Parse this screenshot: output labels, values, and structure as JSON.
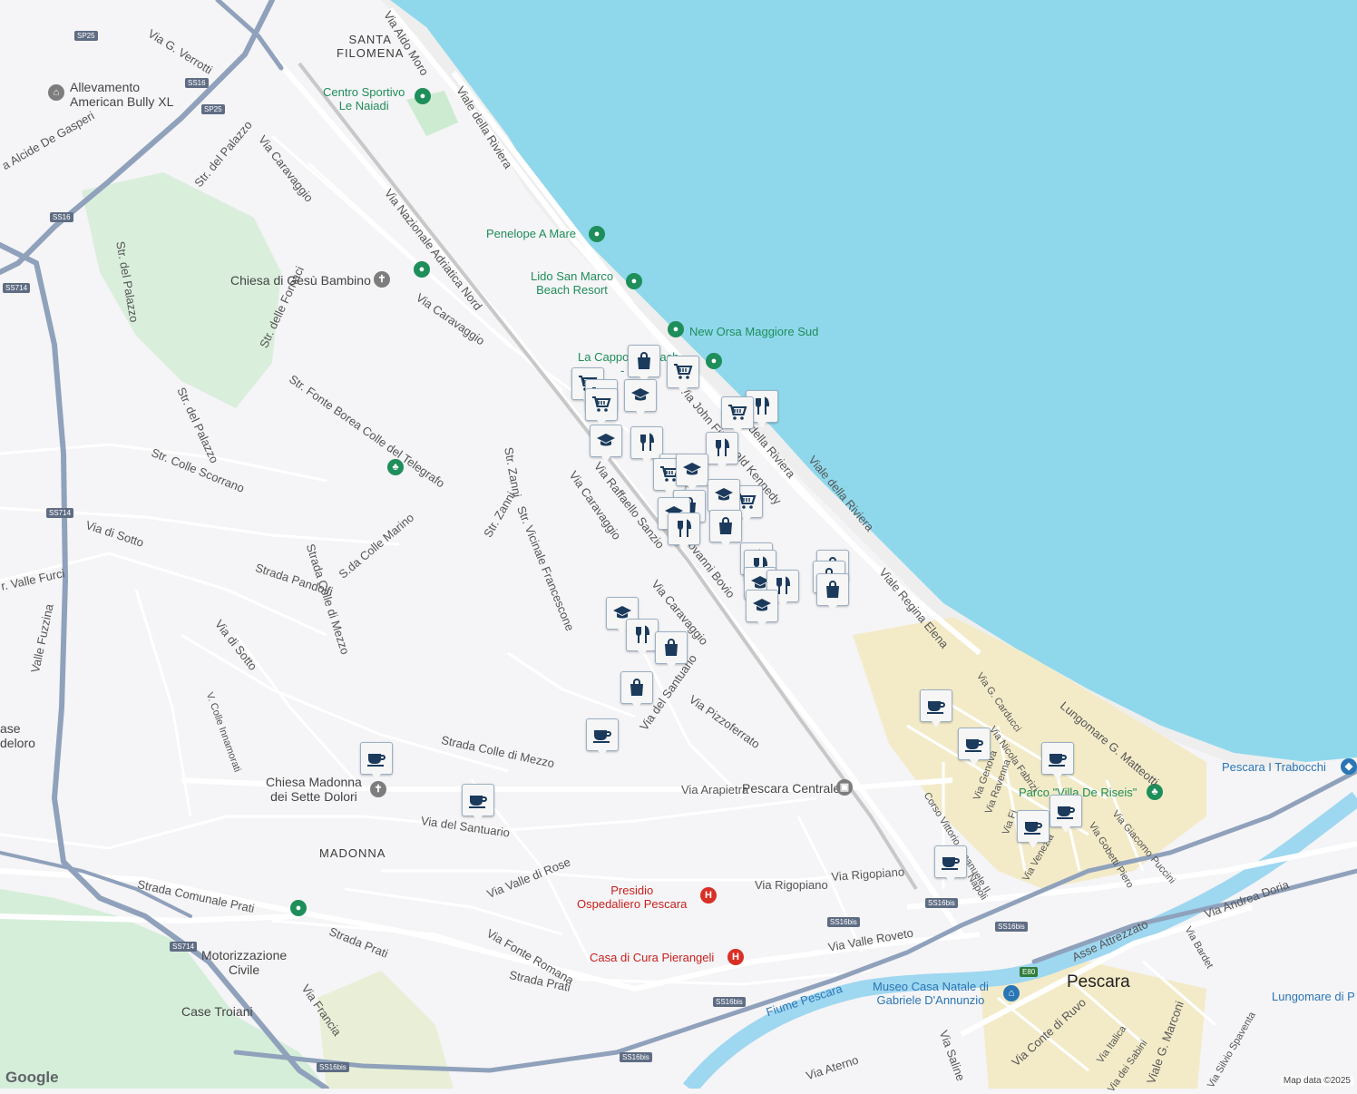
{
  "colors": {
    "sea": "#8fd8ec",
    "land": "#f5f4f6",
    "road": "#ffffff",
    "highway": "#8fa1bb",
    "park": "#cdebd1",
    "river": "#9ed7f0",
    "center": "#f3ebc8",
    "poi_green": "#1e8e5a",
    "marker_navy": "#1b3a5c"
  },
  "areas": {
    "santa_filomena": "SANTA\nFILOMENA",
    "madonna": "MADONNA",
    "case_troiani": "Case Troiani",
    "case_deloro": "ase\ndeloro"
  },
  "city": {
    "pescara": "Pescara"
  },
  "pois": {
    "allevamento": "Allevamento\nAmerican Bully XL",
    "centro_sportivo": "Centro Sportivo\nLe Naiadi",
    "penelope": "Penelope A Mare",
    "lido_san_marco": "Lido San Marco\nBeach Resort",
    "new_orsa": "New Orsa Maggiore Sud",
    "la_capponi": "La Cappo     Beach\n             - S",
    "chiesa_gesu": "Chiesa di Gesù Bambino",
    "chiesa_madonna": "Chiesa Madonna\ndei Sette Dolori",
    "motorizzazione": "Motorizzazione\nCivile",
    "pescara_centrale": "Pescara Centrale",
    "presidio": "Presidio\nOspedaliero Pescara",
    "casa_cura": "Casa di Cura Pierangeli",
    "museo": "Museo Casa Natale di\nGabriele D'Annunzio",
    "parco": "Parco \"Villa De Riseis\"",
    "trabocchi": "Pescara I Trabocchi",
    "lungomare_di_p": "Lungomare di P"
  },
  "streets": {
    "via_g_verrotti": "Via G. Verrotti",
    "via_aldo_moro": "Via Aldo Moro",
    "viale_della_riviera_n": "Viale della Riviera",
    "via_alcide": "a Alcide De Gasperi",
    "str_del_palazzo_1": "Str. del Palazzo",
    "via_caravaggio_1": "Via Caravaggio",
    "via_nazionale": "Via Nazionale Adriatica Nord",
    "str_del_palazzo_2": "Str. del Palazzo",
    "str_delle_fornaci": "Str. delle Fornaci",
    "via_caravaggio_2": "Via Caravaggio",
    "str_fonte_borea": "Str. Fonte Borea Colle del Telegrafo",
    "str_del_palazzo_3": "Str. del Palazzo",
    "str_colle_scorrano": "Str. Colle Scorrano",
    "str_zanni_1": "Str. Zanni",
    "str_zanni_2": "Str. Zanni",
    "str_vicinale": "Str. Vicinale Francescone",
    "via_caravaggio_3": "Via Caravaggio",
    "via_raffaello": "Via Raffaello Sanzio",
    "via_giovanni_bovio": "Via Giovanni Bovio",
    "via_kennedy": "Via John Fitzgerald Kennedy",
    "viale_della_riviera_m": "della Riviera",
    "viale_della_riviera_s": "Viale della Riviera",
    "viale_regina_elena": "Viale Regina Elena",
    "via_di_sotto_1": "Via di Sotto",
    "via_di_sotto_2": "Via di Sotto",
    "strada_pandolfi": "Strada Pandolfi",
    "s_da_colle_marino": "S.da Colle Marino",
    "strada_colle_di_mezzo_v": "Strada Colle di Mezzo",
    "str_valle_furci": "r. Valle Furci",
    "valle_fuzzina": "Valle Fuzzina",
    "via_caravaggio_4": "Via Caravaggio",
    "via_del_santuario_1": "Via del Santuario",
    "via_pizzoferrato": "Via Pizzoferrato",
    "v_colle_innamorati": "V. Colle Innamorati",
    "strada_colle_di_mezzo_h": "Strada Colle di Mezzo",
    "via_arapietra": "Via Arapietra",
    "via_del_santuario_2": "Via del Santuario",
    "via_valle_di_rose": "Via Valle di Rose",
    "via_rigopiano_1": "Via Rigopiano",
    "via_rigopiano_2": "Via Rigopiano",
    "strada_comunale_prati": "Strada Comunale Prati",
    "strada_prati_1": "Strada Prati",
    "strada_prati_2": "Strada Prati",
    "via_fonte_romana": "Via Fonte Romana",
    "via_francia": "Via Francia",
    "via_valle_roveto": "Via Valle Roveto",
    "fiume_pescara": "Fiume Pescara",
    "via_aterno": "Via Aterno",
    "via_saline": "Via Saline",
    "via_conte_di_ruvo": "Via Conte di Ruvo",
    "via_italica": "Via Italica",
    "via_dei_sabini": "Via dei Sabini",
    "viale_g_marconi": "Viale G. Marconi",
    "via_silvio_spaventa": "Via Silvio Spaventa",
    "via_andrea_doria": "Via Andrea Doria",
    "via_bardet": "Via Bardet",
    "asse_attrezzato": "Asse Attrezzato",
    "via_g_carducci": "Via G. Carducci",
    "via_nicola_fabrizi": "Via Nicola Fabrizi",
    "lungomare_matteotti": "Lungomare G. Matteotti",
    "via_genova": "Via Genova",
    "via_ravenna": "Via Ravenna",
    "corso_vittorio": "Corso Vittorio Emanuele II",
    "via_venezia": "Via Venezia",
    "via_gobetti": "Via Gobetti Piero",
    "via_giacomo_puccini": "Via Giacomo Puccini",
    "via_napoli": "Napoli",
    "via_fi": "Via Fi",
    "corso_so": "so"
  },
  "shields": {
    "sp25a": "SP25",
    "ss16a": "SS16",
    "sp25b": "SP25",
    "ss16b": "SS16",
    "ss714a": "SS714",
    "ss714b": "SS714",
    "ss714c": "SS714",
    "ss16bis_a": "SS16bis",
    "ss16bis_b": "SS16bis",
    "ss16bis_c": "SS16bis",
    "ss16bis_d": "SS16bis",
    "ss16bis_e": "SS16bis",
    "ss16bis_f": "SS16bis",
    "e80": "E80"
  },
  "markers": [
    {
      "icon": "shop-bag"
    },
    {
      "icon": "cart"
    },
    {
      "icon": "cart"
    },
    {
      "icon": "cart"
    },
    {
      "icon": "school"
    },
    {
      "icon": "cart"
    },
    {
      "icon": "restaurant"
    },
    {
      "icon": "cart"
    },
    {
      "icon": "restaurant"
    },
    {
      "icon": "school"
    },
    {
      "icon": "restaurant"
    },
    {
      "icon": "restaurant"
    },
    {
      "icon": "cart"
    },
    {
      "icon": "school"
    },
    {
      "icon": "shop-bag"
    },
    {
      "icon": "school"
    },
    {
      "icon": "cart"
    },
    {
      "icon": "school"
    },
    {
      "icon": "restaurant"
    },
    {
      "icon": "shop-bag"
    },
    {
      "icon": "restaurant"
    },
    {
      "icon": "restaurant"
    },
    {
      "icon": "school"
    },
    {
      "icon": "restaurant"
    },
    {
      "icon": "school"
    },
    {
      "icon": "shop-bag"
    },
    {
      "icon": "shop-bag"
    },
    {
      "icon": "shop-bag"
    },
    {
      "icon": "school"
    },
    {
      "icon": "restaurant"
    },
    {
      "icon": "shop-bag"
    },
    {
      "icon": "shop-bag"
    },
    {
      "icon": "cafe"
    },
    {
      "icon": "cafe"
    },
    {
      "icon": "cafe"
    },
    {
      "icon": "cafe"
    },
    {
      "icon": "cafe"
    },
    {
      "icon": "cafe"
    },
    {
      "icon": "cafe"
    },
    {
      "icon": "cafe"
    },
    {
      "icon": "cafe"
    }
  ],
  "footer": {
    "google": "Google",
    "attribution": "Map data ©2025"
  }
}
